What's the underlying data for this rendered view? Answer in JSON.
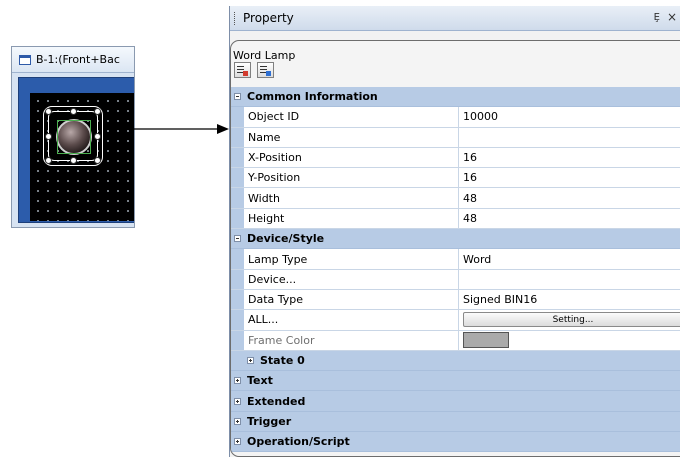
{
  "screen": {
    "title": "B-1:(Front+Bac"
  },
  "property_panel": {
    "title": "Property",
    "pin_glyph": "Ȩ",
    "close_glyph": "×",
    "object_name": "Word Lamp",
    "sections": [
      {
        "label": "Common Information",
        "expanded": true,
        "rows": [
          {
            "name": "Object ID",
            "value": "10000"
          },
          {
            "name": "Name",
            "value": ""
          },
          {
            "name": "X-Position",
            "value": "16"
          },
          {
            "name": "Y-Position",
            "value": "16"
          },
          {
            "name": "Width",
            "value": "48"
          },
          {
            "name": "Height",
            "value": "48"
          }
        ]
      },
      {
        "label": "Device/Style",
        "expanded": true,
        "rows": [
          {
            "name": "Lamp Type",
            "value": "Word"
          },
          {
            "name": "Device...",
            "value": ""
          },
          {
            "name": "Data Type",
            "value": "Signed BIN16"
          },
          {
            "name": "ALL...",
            "button": "Setting..."
          },
          {
            "name": "Frame Color",
            "swatch": "#aaaaaa",
            "disabled": true
          }
        ],
        "subsections": [
          {
            "label": "State 0",
            "expanded": false
          }
        ]
      },
      {
        "label": "Text",
        "expanded": false
      },
      {
        "label": "Extended",
        "expanded": false
      },
      {
        "label": "Trigger",
        "expanded": false
      },
      {
        "label": "Operation/Script",
        "expanded": false
      }
    ]
  },
  "colors": {
    "category_bg": "#b7cbe5",
    "frame_color": "#aaaaaa",
    "screen_bg": "#2c5cab"
  }
}
